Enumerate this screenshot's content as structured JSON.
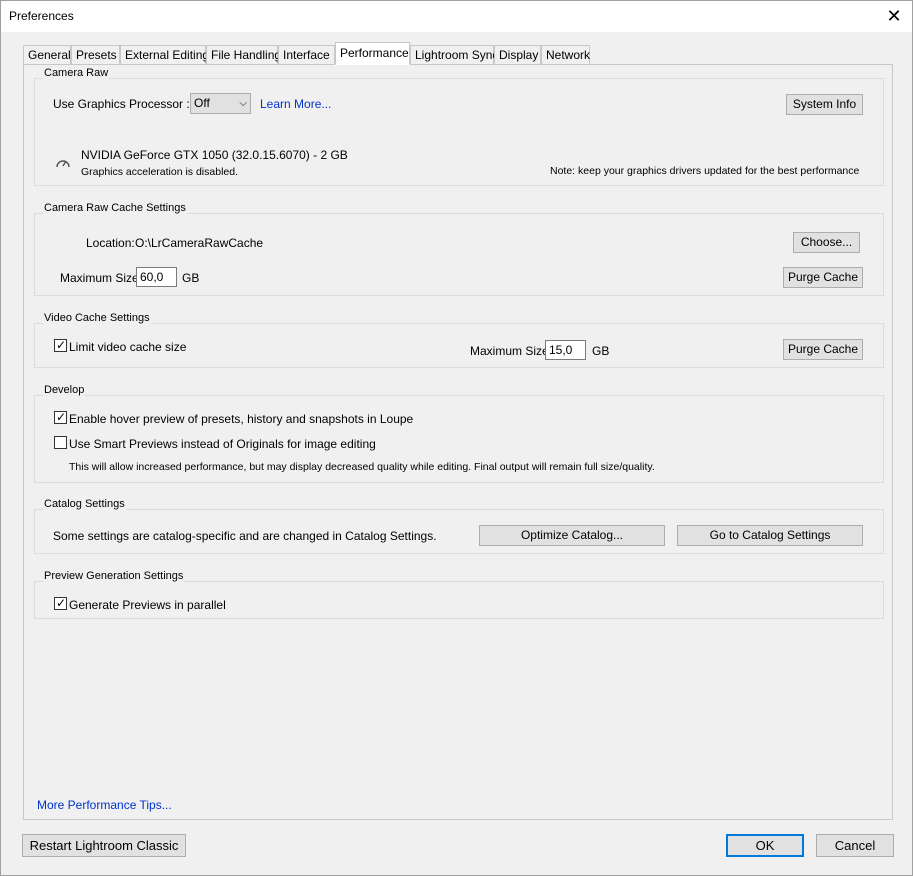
{
  "window": {
    "title": "Preferences"
  },
  "tabs": [
    {
      "label": "General"
    },
    {
      "label": "Presets"
    },
    {
      "label": "External Editing"
    },
    {
      "label": "File Handling"
    },
    {
      "label": "Interface"
    },
    {
      "label": "Performance",
      "active": true
    },
    {
      "label": "Lightroom Sync"
    },
    {
      "label": "Display"
    },
    {
      "label": "Network"
    }
  ],
  "camera_raw": {
    "group_label": "Camera Raw",
    "gpu_label": "Use Graphics Processor :",
    "gpu_value": "Off",
    "learn_more": "Learn More...",
    "system_info": "System Info",
    "gpu_name": "NVIDIA GeForce GTX 1050 (32.0.15.6070) - 2 GB",
    "gpu_status": "Graphics acceleration is disabled.",
    "note": "Note: keep your graphics drivers updated for the best performance"
  },
  "raw_cache": {
    "group_label": "Camera Raw Cache Settings",
    "location_label": "Location:",
    "location_value": "O:\\LrCameraRawCache",
    "choose": "Choose...",
    "max_size_label": "Maximum Size:",
    "max_size_value": "60,0",
    "unit": "GB",
    "purge": "Purge Cache"
  },
  "video_cache": {
    "group_label": "Video Cache Settings",
    "limit_label": "Limit video cache size",
    "limit_checked": true,
    "max_size_label": "Maximum Size:",
    "max_size_value": "15,0",
    "unit": "GB",
    "purge": "Purge Cache"
  },
  "develop": {
    "group_label": "Develop",
    "hover_label": "Enable hover preview of presets, history and snapshots in Loupe",
    "hover_checked": true,
    "smart_label": "Use Smart Previews instead of Originals for image editing",
    "smart_checked": false,
    "smart_note": "This will allow increased performance, but may display decreased quality while editing. Final output will remain full size/quality."
  },
  "catalog": {
    "group_label": "Catalog Settings",
    "desc": "Some settings are catalog-specific and are changed in Catalog Settings.",
    "optimize": "Optimize Catalog...",
    "goto": "Go to Catalog Settings"
  },
  "preview": {
    "group_label": "Preview Generation Settings",
    "parallel_label": "Generate Previews in parallel",
    "parallel_checked": true
  },
  "footer": {
    "tips_link": "More Performance Tips...",
    "restart": "Restart Lightroom Classic",
    "ok": "OK",
    "cancel": "Cancel"
  },
  "check_glyph": "✓",
  "icons": {
    "close": "close-icon",
    "gauge": "gauge-icon",
    "dropdown": "chevron-down-icon"
  }
}
